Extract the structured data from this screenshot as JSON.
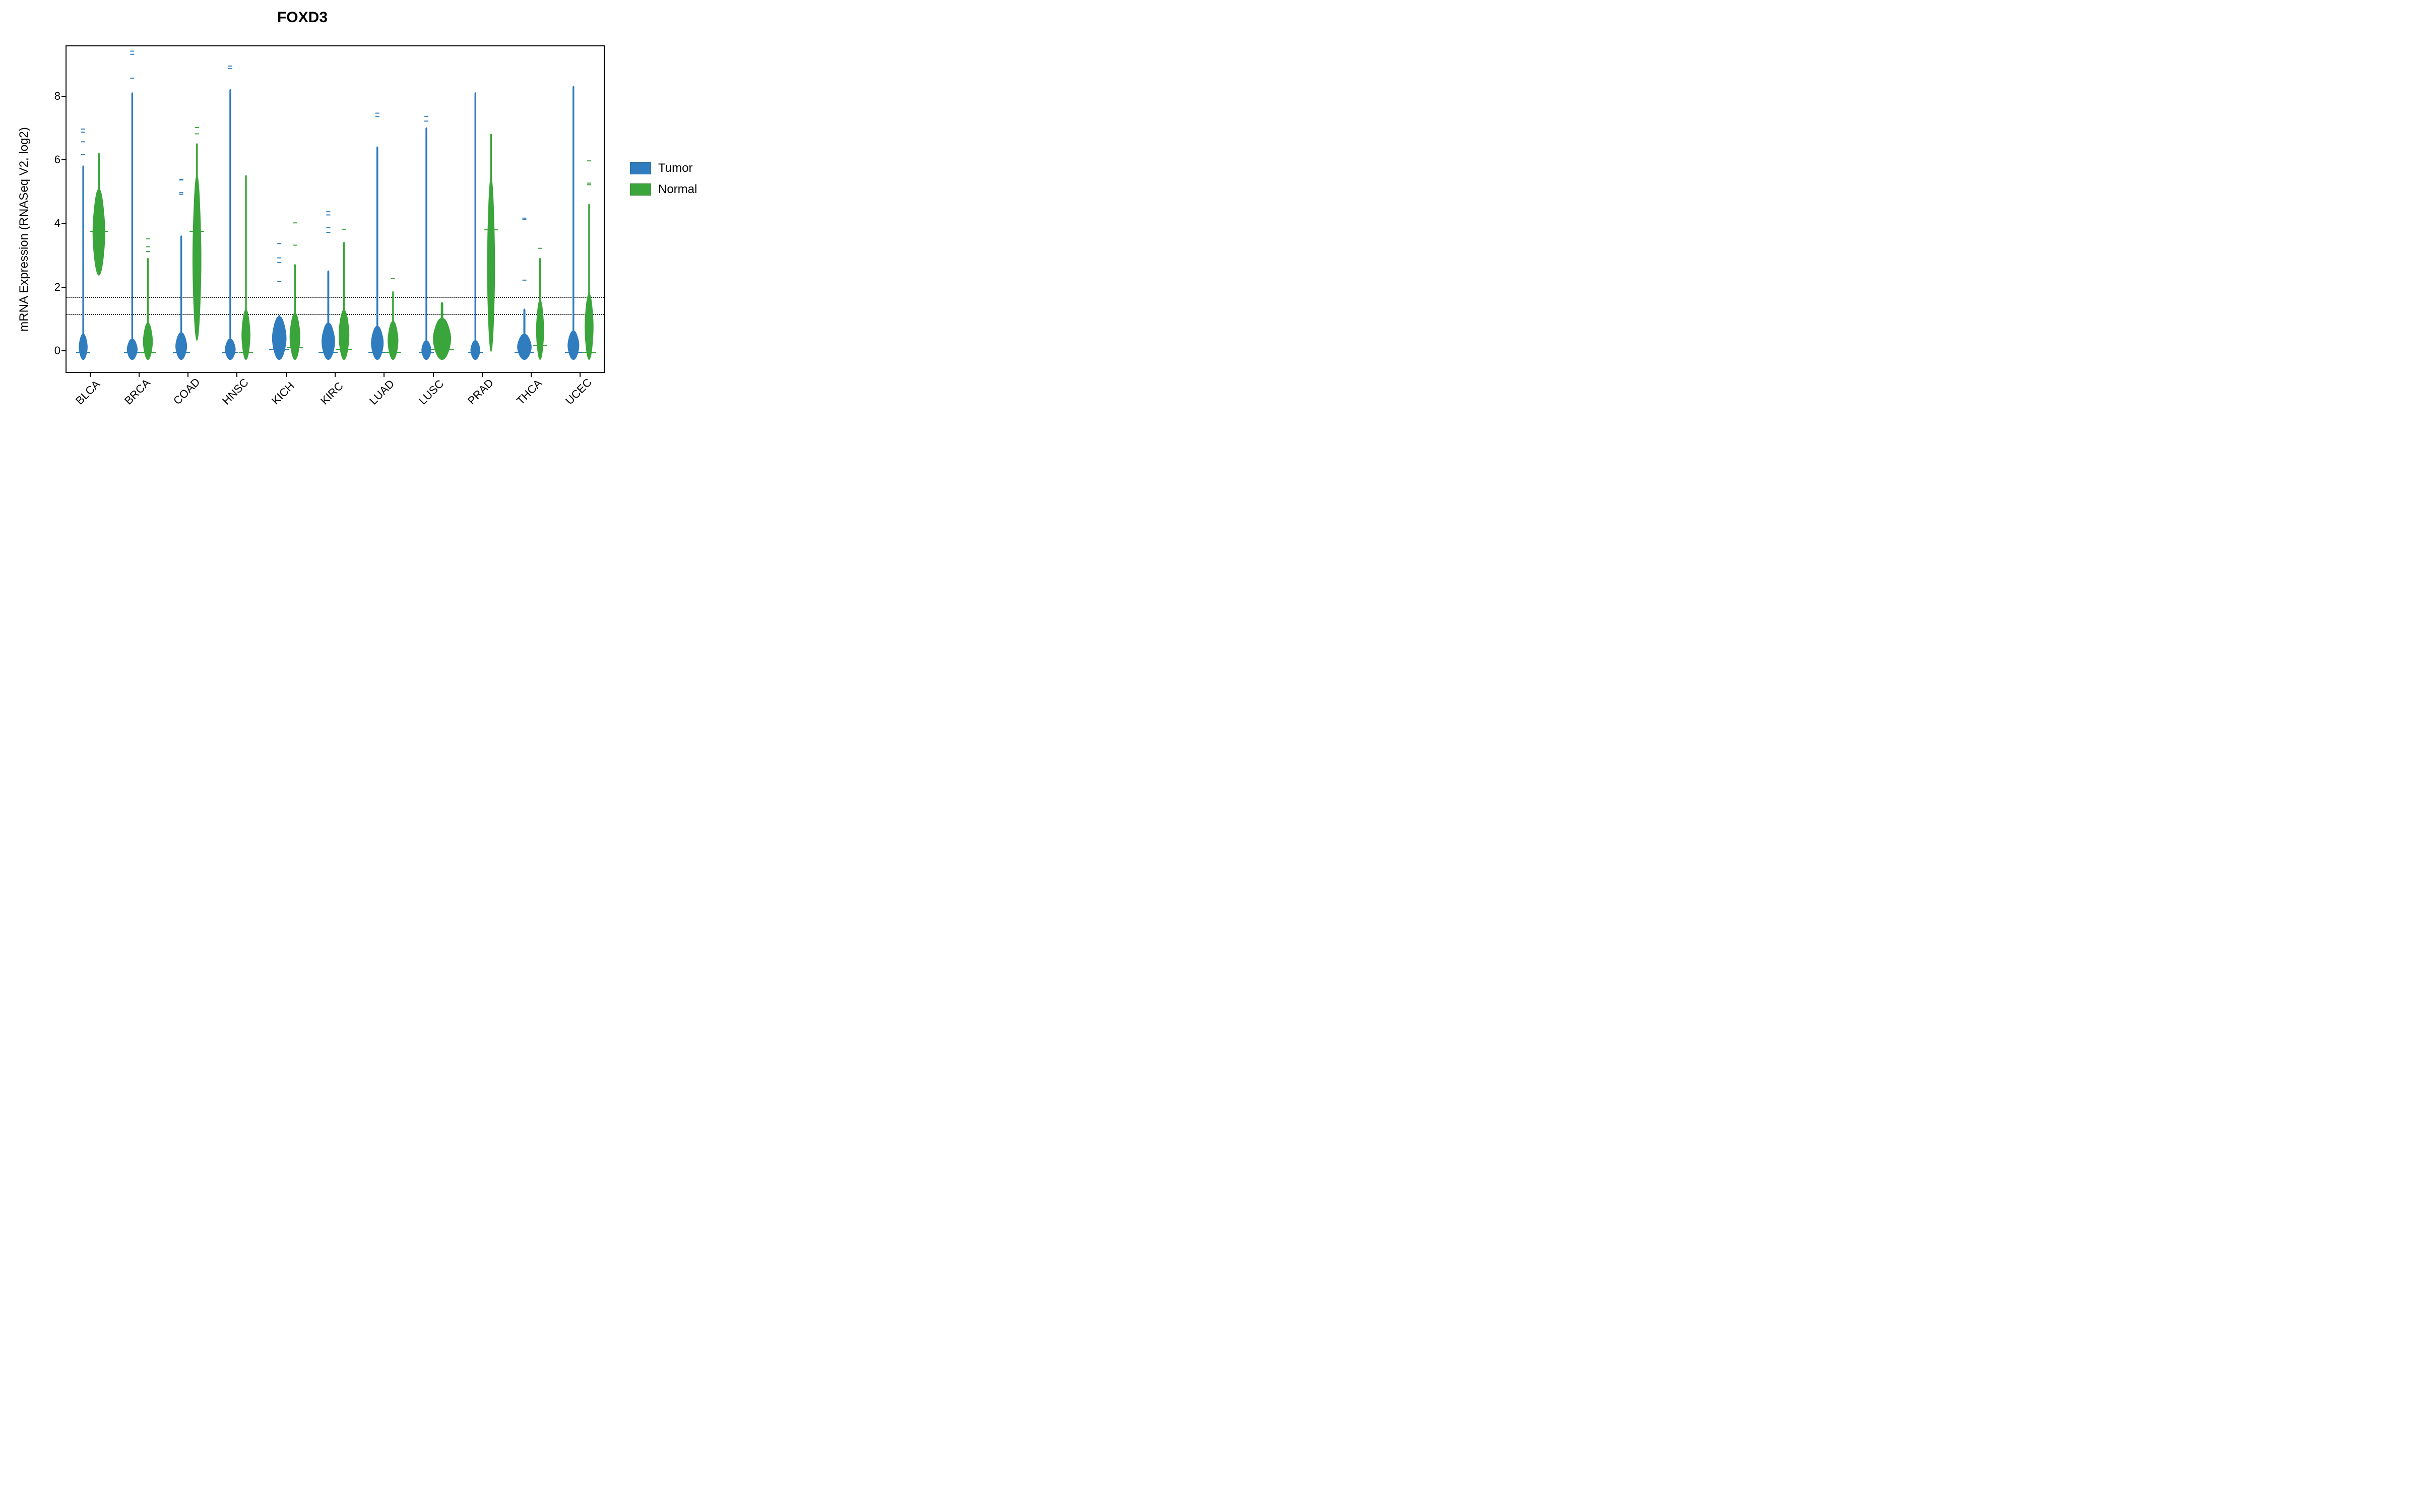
{
  "chart_data": {
    "type": "violin",
    "title": "FOXD3",
    "xlabel": "",
    "ylabel": "mRNA Expression (RNASeq V2, log2)",
    "ylim": [
      -0.7,
      9.6
    ],
    "yticks": [
      0,
      2,
      4,
      6,
      8
    ],
    "categories": [
      "BLCA",
      "BRCA",
      "COAD",
      "HNSC",
      "KICH",
      "KIRC",
      "LUAD",
      "LUSC",
      "PRAD",
      "THCA",
      "UCEC"
    ],
    "series": [
      {
        "name": "Tumor",
        "color": "#2f7cbf"
      },
      {
        "name": "Normal",
        "color": "#3aa53a"
      }
    ],
    "reference_lines": [
      1.18,
      1.72
    ],
    "violins": {
      "BLCA": {
        "Tumor": {
          "median": 0.0,
          "bulk_top": 0.55,
          "tail_top": 5.8,
          "outliers": [
            6.2,
            6.6,
            6.9,
            7.0
          ],
          "bulk_width": 0.45
        },
        "Normal": {
          "median": 3.8,
          "bulk_low": 2.4,
          "bulk_top": 5.1,
          "tail_top": 6.2,
          "outliers": [],
          "bulk_width": 0.65
        }
      },
      "BRCA": {
        "Tumor": {
          "median": 0.0,
          "bulk_top": 0.4,
          "tail_top": 8.1,
          "outliers": [
            8.6,
            9.35,
            9.45
          ],
          "bulk_width": 0.55
        },
        "Normal": {
          "median": 0.0,
          "bulk_top": 0.9,
          "tail_top": 2.9,
          "outliers": [
            3.15,
            3.3,
            3.55
          ],
          "bulk_width": 0.5
        }
      },
      "COAD": {
        "Tumor": {
          "median": 0.0,
          "bulk_top": 0.6,
          "tail_top": 3.6,
          "outliers": [
            4.95,
            5.0,
            5.4,
            5.42
          ],
          "bulk_width": 0.6
        },
        "Normal": {
          "median": 3.8,
          "bulk_low": 0.35,
          "bulk_top": 5.5,
          "tail_top": 6.5,
          "outliers": [
            6.85,
            7.05
          ],
          "bulk_width": 0.45
        }
      },
      "HNSC": {
        "Tumor": {
          "median": 0.0,
          "bulk_top": 0.4,
          "tail_top": 8.2,
          "outliers": [
            8.9,
            8.98
          ],
          "bulk_width": 0.55
        },
        "Normal": {
          "median": 0.0,
          "bulk_top": 1.3,
          "tail_top": 5.5,
          "outliers": [],
          "bulk_width": 0.45
        }
      },
      "KICH": {
        "Tumor": {
          "median": 0.1,
          "bulk_top": 1.1,
          "tail_top": 1.1,
          "outliers": [
            2.2,
            2.8,
            2.95,
            3.4
          ],
          "bulk_width": 0.75
        },
        "Normal": {
          "median": 0.15,
          "bulk_top": 1.2,
          "tail_top": 2.7,
          "outliers": [
            3.35,
            4.05
          ],
          "bulk_width": 0.55
        }
      },
      "KIRC": {
        "Tumor": {
          "median": 0.0,
          "bulk_top": 0.9,
          "tail_top": 2.5,
          "outliers": [
            3.75,
            3.9,
            4.3,
            4.4
          ],
          "bulk_width": 0.7
        },
        "Normal": {
          "median": 0.1,
          "bulk_top": 1.3,
          "tail_top": 3.4,
          "outliers": [
            3.85
          ],
          "bulk_width": 0.55
        }
      },
      "LUAD": {
        "Tumor": {
          "median": 0.0,
          "bulk_top": 0.8,
          "tail_top": 6.4,
          "outliers": [
            7.4,
            7.5
          ],
          "bulk_width": 0.65
        },
        "Normal": {
          "median": 0.0,
          "bulk_top": 0.95,
          "tail_top": 1.85,
          "outliers": [
            2.3
          ],
          "bulk_width": 0.55
        }
      },
      "LUSC": {
        "Tumor": {
          "median": 0.0,
          "bulk_top": 0.35,
          "tail_top": 7.0,
          "outliers": [
            7.25,
            7.4
          ],
          "bulk_width": 0.5
        },
        "Normal": {
          "median": 0.1,
          "bulk_top": 1.05,
          "tail_top": 1.5,
          "outliers": [],
          "bulk_width": 0.95
        }
      },
      "PRAD": {
        "Tumor": {
          "median": 0.0,
          "bulk_top": 0.35,
          "tail_top": 8.1,
          "outliers": [],
          "bulk_width": 0.5
        },
        "Normal": {
          "median": 3.85,
          "bulk_low": 0.0,
          "bulk_top": 5.4,
          "tail_top": 6.8,
          "outliers": [],
          "bulk_width": 0.4
        }
      },
      "THCA": {
        "Tumor": {
          "median": 0.0,
          "bulk_top": 0.55,
          "tail_top": 1.3,
          "outliers": [
            2.25,
            4.15,
            4.2
          ],
          "bulk_width": 0.75
        },
        "Normal": {
          "median": 0.2,
          "bulk_top": 1.6,
          "tail_top": 2.9,
          "outliers": [
            3.25
          ],
          "bulk_width": 0.4
        }
      },
      "UCEC": {
        "Tumor": {
          "median": 0.0,
          "bulk_top": 0.65,
          "tail_top": 8.3,
          "outliers": [],
          "bulk_width": 0.6
        },
        "Normal": {
          "median": 0.0,
          "bulk_top": 1.8,
          "tail_top": 4.6,
          "outliers": [
            5.25,
            5.3,
            6.0
          ],
          "bulk_width": 0.45
        }
      }
    },
    "legend_position": "right"
  },
  "legend": {
    "items": [
      {
        "label": "Tumor",
        "color": "#2f7cbf"
      },
      {
        "label": "Normal",
        "color": "#3aa53a"
      }
    ]
  }
}
